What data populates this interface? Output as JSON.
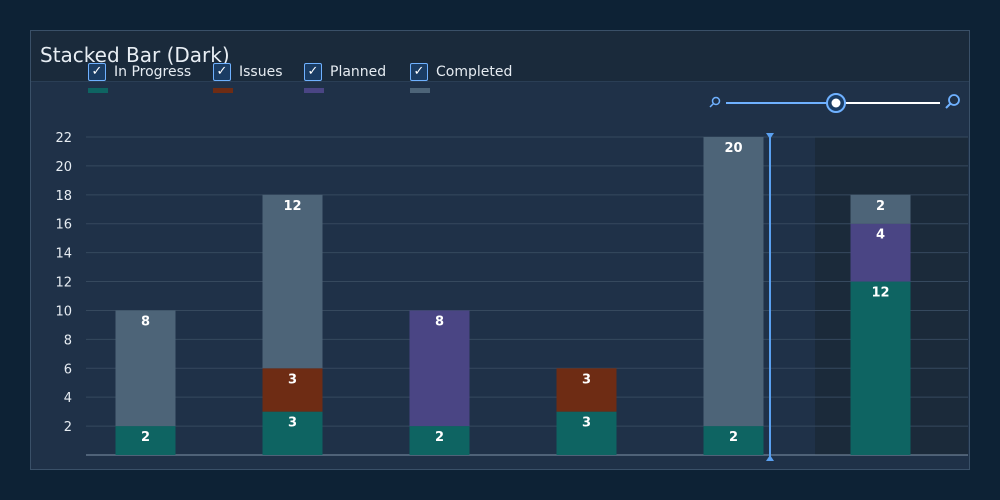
{
  "title": "Stacked Bar (Dark)",
  "legend": [
    {
      "label": "In Progress",
      "color": "#0e6462"
    },
    {
      "label": "Issues",
      "color": "#6e2c14"
    },
    {
      "label": "Planned",
      "color": "#4a4584"
    },
    {
      "label": "Completed",
      "color": "#4d6478"
    }
  ],
  "slider": {
    "value": 0.5,
    "min_icon": "zoom-out-icon",
    "max_icon": "zoom-in-icon"
  },
  "chart_data": {
    "type": "bar",
    "stacked": true,
    "categories": [
      "",
      "",
      "",
      "",
      "",
      ""
    ],
    "series": [
      {
        "name": "In Progress",
        "values": [
          2,
          3,
          2,
          3,
          2,
          12
        ]
      },
      {
        "name": "Issues",
        "values": [
          0,
          3,
          0,
          3,
          0,
          0
        ]
      },
      {
        "name": "Planned",
        "values": [
          0,
          0,
          8,
          0,
          0,
          4
        ]
      },
      {
        "name": "Completed",
        "values": [
          8,
          12,
          0,
          0,
          20,
          2
        ]
      }
    ],
    "yticks": [
      2,
      4,
      6,
      8,
      10,
      12,
      14,
      16,
      18,
      20,
      22
    ],
    "ylim": [
      0,
      22
    ],
    "grid": true,
    "legend_position": "top-left",
    "highlighted_category_index": 5
  }
}
